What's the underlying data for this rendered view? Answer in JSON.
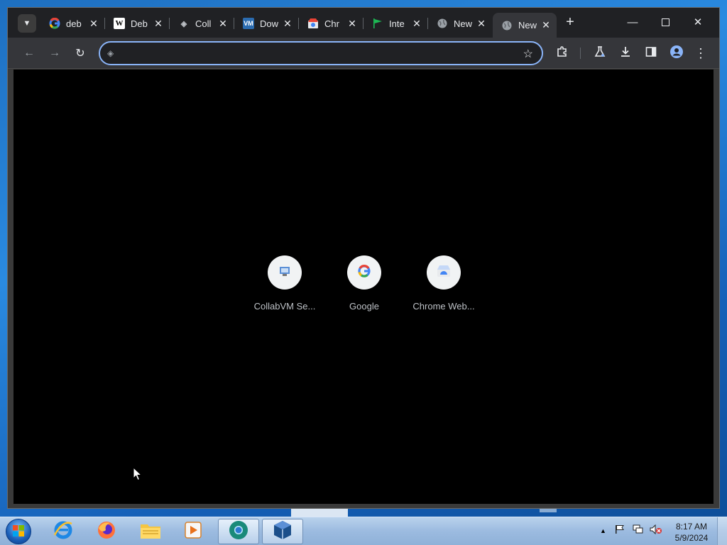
{
  "browser": {
    "tabs": [
      {
        "title": "deb",
        "icon": "google-icon"
      },
      {
        "title": "Deb",
        "icon": "wikipedia-icon"
      },
      {
        "title": "Coll",
        "icon": "collabvm-icon"
      },
      {
        "title": "Dow",
        "icon": "download-page-icon"
      },
      {
        "title": "Chr",
        "icon": "chrome-web-store-icon"
      },
      {
        "title": "Inte",
        "icon": "green-flag-icon"
      },
      {
        "title": "New",
        "icon": "globe-icon"
      },
      {
        "title": "New",
        "icon": "globe-icon",
        "active": true
      }
    ],
    "omnibox": {
      "value": "",
      "placeholder": ""
    },
    "shortcuts": [
      {
        "label": "CollabVM Se...",
        "icon": "collabvm-icon"
      },
      {
        "label": "Google",
        "icon": "google-icon"
      },
      {
        "label": "Chrome Web...",
        "icon": "chrome-web-store-icon"
      }
    ],
    "colors": {
      "accent": "#8ab4f8",
      "frame": "#202124",
      "toolbar": "#35363a",
      "content": "#000000"
    }
  },
  "taskbar": {
    "apps": [
      "internet-explorer",
      "firefox",
      "file-explorer",
      "media-player",
      "chromium",
      "virtualbox"
    ],
    "clock": {
      "time": "8:17 AM",
      "date": "5/9/2024"
    }
  }
}
